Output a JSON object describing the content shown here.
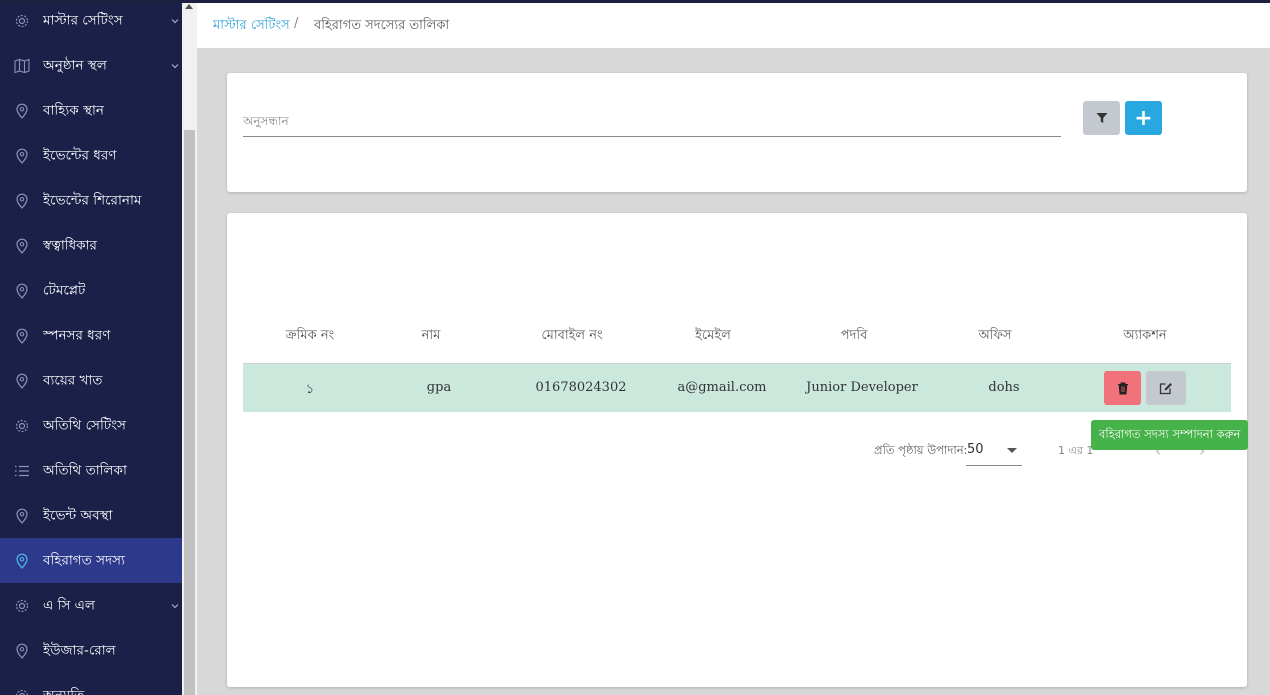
{
  "sidebar": {
    "items": [
      {
        "label": "মাস্টার সেটিংস",
        "icon": "gear-icon",
        "chevron": true,
        "active": false
      },
      {
        "label": "অনুষ্ঠান স্থল",
        "icon": "map-icon",
        "chevron": true,
        "active": false
      },
      {
        "label": "বাহ্যিক স্থান",
        "icon": "location-pin-icon",
        "chevron": false,
        "active": false
      },
      {
        "label": "ইভেন্টের ধরণ",
        "icon": "location-pin-icon",
        "chevron": false,
        "active": false
      },
      {
        "label": "ইভেন্টের শিরোনাম",
        "icon": "location-pin-icon",
        "chevron": false,
        "active": false
      },
      {
        "label": "স্বত্বাধিকার",
        "icon": "location-pin-icon",
        "chevron": false,
        "active": false
      },
      {
        "label": "টেমপ্লেট",
        "icon": "location-pin-icon",
        "chevron": false,
        "active": false
      },
      {
        "label": "স্পনসর ধরণ",
        "icon": "location-pin-icon",
        "chevron": false,
        "active": false
      },
      {
        "label": "ব্যয়ের খাত",
        "icon": "location-pin-icon",
        "chevron": false,
        "active": false
      },
      {
        "label": "অতিথি সেটিংস",
        "icon": "gear-icon",
        "chevron": false,
        "active": false
      },
      {
        "label": "অতিথি তালিকা",
        "icon": "list-icon",
        "chevron": false,
        "active": false
      },
      {
        "label": "ইভেন্ট অবস্থা",
        "icon": "location-pin-icon",
        "chevron": false,
        "active": false
      },
      {
        "label": "বহিরাগত সদস্য",
        "icon": "location-pin-icon",
        "chevron": false,
        "active": true
      },
      {
        "label": "এ সি এল",
        "icon": "gear-icon",
        "chevron": true,
        "active": false
      },
      {
        "label": "ইউজার-রোল",
        "icon": "location-pin-icon",
        "chevron": false,
        "active": false
      },
      {
        "label": "অনুমতি",
        "icon": "gear-icon",
        "chevron": false,
        "active": false
      }
    ]
  },
  "breadcrumb": {
    "root": "মাস্টার সেটিংস",
    "separator": "/",
    "current": "বহিরাগত সদস্যের তালিকা"
  },
  "search": {
    "placeholder": "অনুসন্ধান",
    "filter_icon": "filter-icon",
    "add_label": "+"
  },
  "table": {
    "columns": [
      "ক্রমিক নং",
      "নাম",
      "মোবাইল নং",
      "ইমেইল",
      "পদবি",
      "অফিস",
      "অ্যাকশন"
    ],
    "rows": [
      {
        "serial": "১",
        "name": "gpa",
        "mobile": "01678024302",
        "email": "a@gmail.com",
        "designation": "Junior Developer",
        "office": "dohs"
      }
    ]
  },
  "pagination": {
    "per_page_label": "প্রতি পৃষ্ঠায় উপাদান:",
    "per_page_value": "50",
    "range": "1 এর 1",
    "prev": "‹",
    "next": "›"
  },
  "tooltip": {
    "text": "বহিরাগত সদস্য সম্পাদনা করুন"
  },
  "colors": {
    "sidebar_bg": "#1b2048",
    "sidebar_active": "#2d3a8c",
    "accent": "#29a7e1",
    "row_highlight": "#cbe8dd",
    "delete": "#f2727b",
    "tooltip": "#46b24a"
  }
}
